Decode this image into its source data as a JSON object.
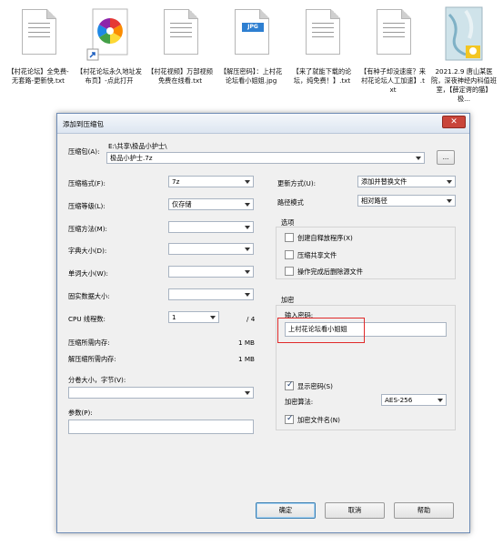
{
  "desktop": {
    "files": [
      {
        "name": "【村花论坛】全免费-无套路-更新快.txt",
        "kind": "txt"
      },
      {
        "name": "【村花论坛永久地址发布页】-点此打开",
        "kind": "shortcut"
      },
      {
        "name": "【村花视频】万部视频免费在线看.txt",
        "kind": "txt"
      },
      {
        "name": "【解压密码】：上村花论坛看小姐姐.jpg",
        "kind": "jpg",
        "badge": "JPG"
      },
      {
        "name": "【来了就能下载的论坛，纯免费！】.txt",
        "kind": "txt"
      },
      {
        "name": "【有种子却没速度？来村花论坛人工加速】.txt",
        "kind": "txt"
      },
      {
        "name": "2021.2.9 唐山某医院，深夜神经内科值班室，【薛定谔的猫】极...",
        "kind": "video"
      }
    ]
  },
  "dialog": {
    "title": "添加到压缩包",
    "archive_label": "压缩包(A):",
    "archive_path": "E:\\共享\\极品小护士\\",
    "archive_name": "极品小护士.7z",
    "browse": "...",
    "left": {
      "format_label": "压缩格式(F):",
      "format_value": "7z",
      "level_label": "压缩等级(L):",
      "level_value": "仅存储",
      "method_label": "压缩方法(M):",
      "method_value": "",
      "dict_label": "字典大小(D):",
      "dict_value": "",
      "word_label": "单词大小(W):",
      "word_value": "",
      "solid_label": "固实数据大小:",
      "solid_value": "",
      "threads_label": "CPU 线程数:",
      "threads_value": "1",
      "threads_total": "/ 4",
      "mem_compress_label": "压缩所需内存:",
      "mem_compress_value": "1 MB",
      "mem_decompress_label": "解压缩所需内存:",
      "mem_decompress_value": "1 MB",
      "split_label": "分卷大小，字节(V):",
      "split_value": "",
      "params_label": "参数(P):",
      "params_value": ""
    },
    "right": {
      "update_label": "更新方式(U):",
      "update_value": "添加并替换文件",
      "pathmode_label": "路径模式",
      "pathmode_value": "相对路径",
      "options_title": "选项",
      "opt_sfx": "创建自释放程序(X)",
      "opt_shared": "压缩共享文件",
      "opt_delete": "操作完成后删除源文件",
      "encrypt_title": "加密",
      "password_label": "输入密码:",
      "password_value": "上村花论坛看小姐姐",
      "show_password": "显示密码(S)",
      "enc_method_label": "加密算法:",
      "enc_method_value": "AES-256",
      "encrypt_names": "加密文件名(N)"
    },
    "buttons": {
      "ok": "确定",
      "cancel": "取消",
      "help": "帮助"
    }
  },
  "colors": {
    "highlight_box": "#e02a2a",
    "dialog_bg": "#f0f0f0",
    "close_red": "#c9453a"
  }
}
